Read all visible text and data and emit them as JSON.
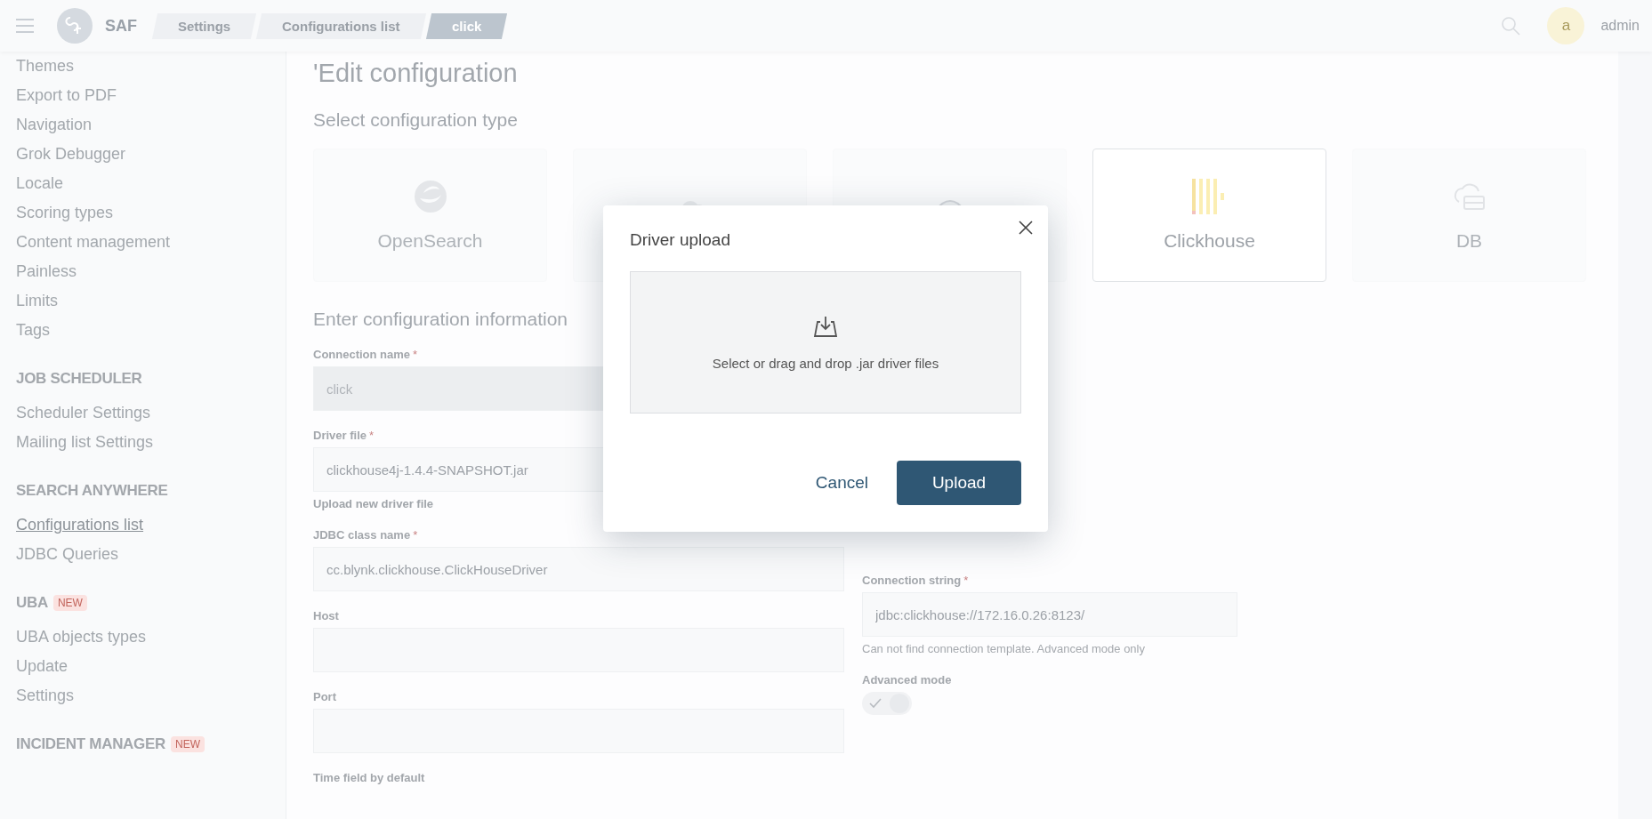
{
  "header": {
    "app_name": "SAF",
    "breadcrumbs": [
      {
        "label": "Settings",
        "selected": false
      },
      {
        "label": "Configurations list",
        "selected": false
      },
      {
        "label": "click",
        "selected": true
      }
    ],
    "avatar_letter": "a",
    "user": "admin"
  },
  "sidebar": {
    "sections": [
      {
        "items": [
          {
            "label": "Themes",
            "selected": false
          },
          {
            "label": "Export to PDF",
            "selected": false
          },
          {
            "label": "Navigation",
            "selected": false
          },
          {
            "label": "Grok Debugger",
            "selected": false
          },
          {
            "label": "Locale",
            "selected": false
          },
          {
            "label": "Scoring types",
            "selected": false
          },
          {
            "label": "Content management",
            "selected": false
          },
          {
            "label": "Painless",
            "selected": false
          },
          {
            "label": "Limits",
            "selected": false
          },
          {
            "label": "Tags",
            "selected": false
          }
        ]
      },
      {
        "heading": "JOB SCHEDULER",
        "items": [
          {
            "label": "Scheduler Settings",
            "selected": false
          },
          {
            "label": "Mailing list Settings",
            "selected": false
          }
        ]
      },
      {
        "heading": "SEARCH ANYWHERE",
        "items": [
          {
            "label": "Configurations list",
            "selected": true
          },
          {
            "label": "JDBC Queries",
            "selected": false
          }
        ]
      },
      {
        "heading": "UBA",
        "badge": "NEW",
        "items": [
          {
            "label": "UBA objects types",
            "selected": false
          },
          {
            "label": "Update",
            "selected": false
          },
          {
            "label": "Settings",
            "selected": false
          }
        ]
      },
      {
        "heading": "INCIDENT MANAGER",
        "badge": "NEW"
      }
    ]
  },
  "page": {
    "title": "'Edit configuration",
    "type_heading": "Select configuration type",
    "types": [
      {
        "kind": "opensearch",
        "label": "OpenSearch",
        "selected": false
      },
      {
        "kind": "elephant",
        "selected": false
      },
      {
        "kind": "animal",
        "selected": false
      },
      {
        "kind": "clickhouse",
        "label": "Clickhouse",
        "selected": true
      },
      {
        "kind": "db",
        "label": "DB",
        "selected": false
      }
    ],
    "info_heading": "Enter configuration information",
    "left_fields": [
      {
        "kind": "input",
        "label": "Connection name",
        "required_mark": "*",
        "value": "click",
        "disabled": true
      },
      {
        "kind": "input",
        "label": "Driver file",
        "required_mark": "*",
        "value": "clickhouse4j-1.4.4-SNAPSHOT.jar",
        "disabled": false,
        "link": "Upload new driver file"
      },
      {
        "kind": "input",
        "label": "JDBC class name",
        "required_mark": "*",
        "value": "cc.blynk.clickhouse.ClickHouseDriver",
        "disabled": false
      },
      {
        "kind": "input",
        "label": "Host",
        "disabled": false
      },
      {
        "kind": "input",
        "label": "Port",
        "disabled": false
      },
      {
        "kind": "label",
        "label": "Time field by default"
      }
    ],
    "right_fields": [
      {
        "kind": "input",
        "label": "Connection string",
        "required_mark": "*",
        "value": "jdbc:clickhouse://172.16.0.26:8123/",
        "hint": "Can not find connection template. Advanced mode only"
      },
      {
        "kind": "switch",
        "label": "Advanced mode",
        "on": true
      }
    ]
  },
  "dialog": {
    "title": "Driver upload",
    "dropzone_text": "Select or drag and drop .jar driver files",
    "buttons": [
      {
        "kind": "link",
        "label": "Cancel"
      },
      {
        "kind": "primary",
        "label": "Upload"
      }
    ]
  }
}
